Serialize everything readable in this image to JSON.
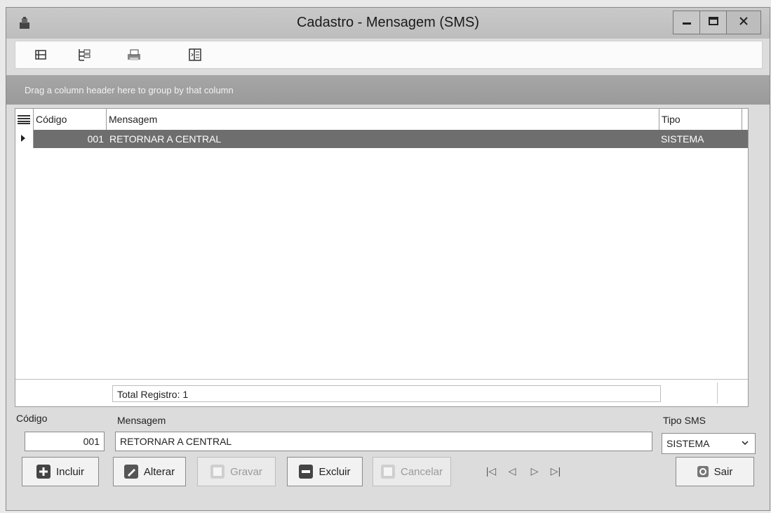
{
  "window": {
    "title": "Cadastro - Mensagem (SMS)"
  },
  "toolbar": {
    "icons": [
      "grid-layout-icon",
      "tree-view-icon",
      "print-icon",
      "column-chooser-icon"
    ]
  },
  "grid": {
    "group_prompt": "Drag a column header here to group by that column",
    "columns": [
      "Código",
      "Mensagem",
      "Tipo"
    ],
    "rows": [
      {
        "codigo": "001",
        "mensagem": "RETORNAR A CENTRAL",
        "tipo": "SISTEMA"
      }
    ],
    "footer_total": "Total Registro: 1"
  },
  "form": {
    "codigo_label": "Código",
    "codigo_value": "001",
    "mensagem_label": "Mensagem",
    "mensagem_value": "RETORNAR A CENTRAL",
    "tipo_label": "Tipo SMS",
    "tipo_value": "SISTEMA"
  },
  "buttons": {
    "incluir": "Incluir",
    "alterar": "Alterar",
    "gravar": "Gravar",
    "excluir": "Excluir",
    "cancelar": "Cancelar",
    "sair": "Sair"
  },
  "navigation": {
    "first": "|◁",
    "prev": "◁",
    "next": "▷",
    "last": "▷|"
  },
  "colors": {
    "selected_row": "#6e6e6e",
    "group_panel": "#a0a0a0"
  }
}
